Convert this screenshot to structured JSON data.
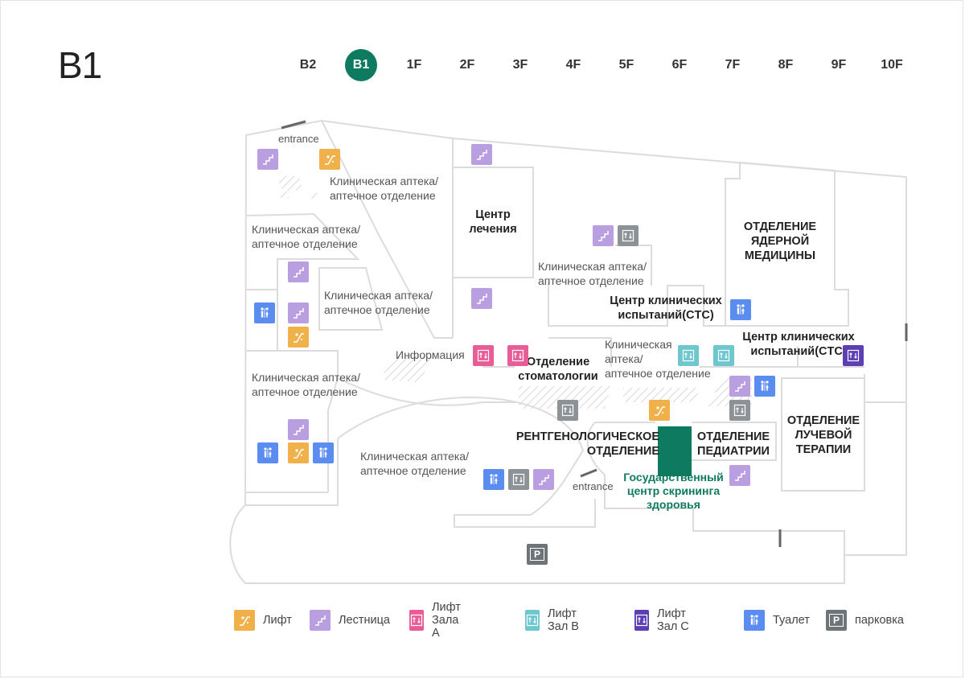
{
  "floor": {
    "current": "B1"
  },
  "floor_tabs": [
    {
      "label": "B2",
      "active": false
    },
    {
      "label": "B1",
      "active": true
    },
    {
      "label": "1F",
      "active": false
    },
    {
      "label": "2F",
      "active": false
    },
    {
      "label": "3F",
      "active": false
    },
    {
      "label": "4F",
      "active": false
    },
    {
      "label": "5F",
      "active": false
    },
    {
      "label": "6F",
      "active": false
    },
    {
      "label": "7F",
      "active": false
    },
    {
      "label": "8F",
      "active": false
    },
    {
      "label": "9F",
      "active": false
    },
    {
      "label": "10F",
      "active": false
    }
  ],
  "map_labels": {
    "entrance_top": "entrance",
    "entrance_bottom": "entrance",
    "pharmacy_1": "Клиническая аптека/\nаптечное отделение",
    "pharmacy_2": "Клиническая аптека/\nаптечное отделение",
    "pharmacy_3": "Клиническая аптека/\nаптечное отделение",
    "pharmacy_4": "Клиническая аптека/\nаптечное отделение",
    "pharmacy_5": "Клиническая аптека/\nаптечное отделение",
    "pharmacy_6": "Клиническая аптека/\nаптечное отделение",
    "pharmacy_7": "Клиническая\nаптека/\nаптечное отделение",
    "treatment_center": "Центр\nлечения",
    "nuclear_medicine": "ОТДЕЛЕНИЕ\nЯДЕРНОЙ\nМЕДИЦИНЫ",
    "ctc_1": "Центр клинических\nиспытаний(CTC)",
    "ctc_2": "Центр клинических\nиспытаний(CTC)",
    "information": "Информация",
    "dentistry": "Отделение\nстоматологии",
    "radiology": "РЕНТГЕНОЛОГИЧЕСКОЕ\nОТДЕЛЕНИЕ",
    "pediatrics": "ОТДЕЛЕНИЕ\nПЕДИАТРИИ",
    "radiation_therapy": "ОТДЕЛЕНИЕ\nЛУЧЕВОЙ\nТЕРАПИИ",
    "health_screening": "Государственный\nцентр скрининга\nздоровья"
  },
  "legend": [
    {
      "icon": "lift-icon",
      "label": "Лифт"
    },
    {
      "icon": "stairs-icon",
      "label": "Лестница"
    },
    {
      "icon": "elevator-a-icon",
      "label": "Лифт Зала A"
    },
    {
      "icon": "elevator-b-icon",
      "label": "Лифт Зал B"
    },
    {
      "icon": "elevator-c-icon",
      "label": "Лифт Зал C"
    },
    {
      "icon": "restroom-icon",
      "label": "Туалет"
    },
    {
      "icon": "parking-icon",
      "label": "парковка"
    }
  ],
  "parking_symbol": "P",
  "colors": {
    "accent": "#0e7a5f",
    "lift": "#f0b14b",
    "stairs": "#b99ee0",
    "elevator_a": "#e85d97",
    "elevator_b": "#6ec6cf",
    "elevator_c": "#5c3fb3",
    "restroom": "#5b8df0",
    "parking": "#6f7479"
  }
}
